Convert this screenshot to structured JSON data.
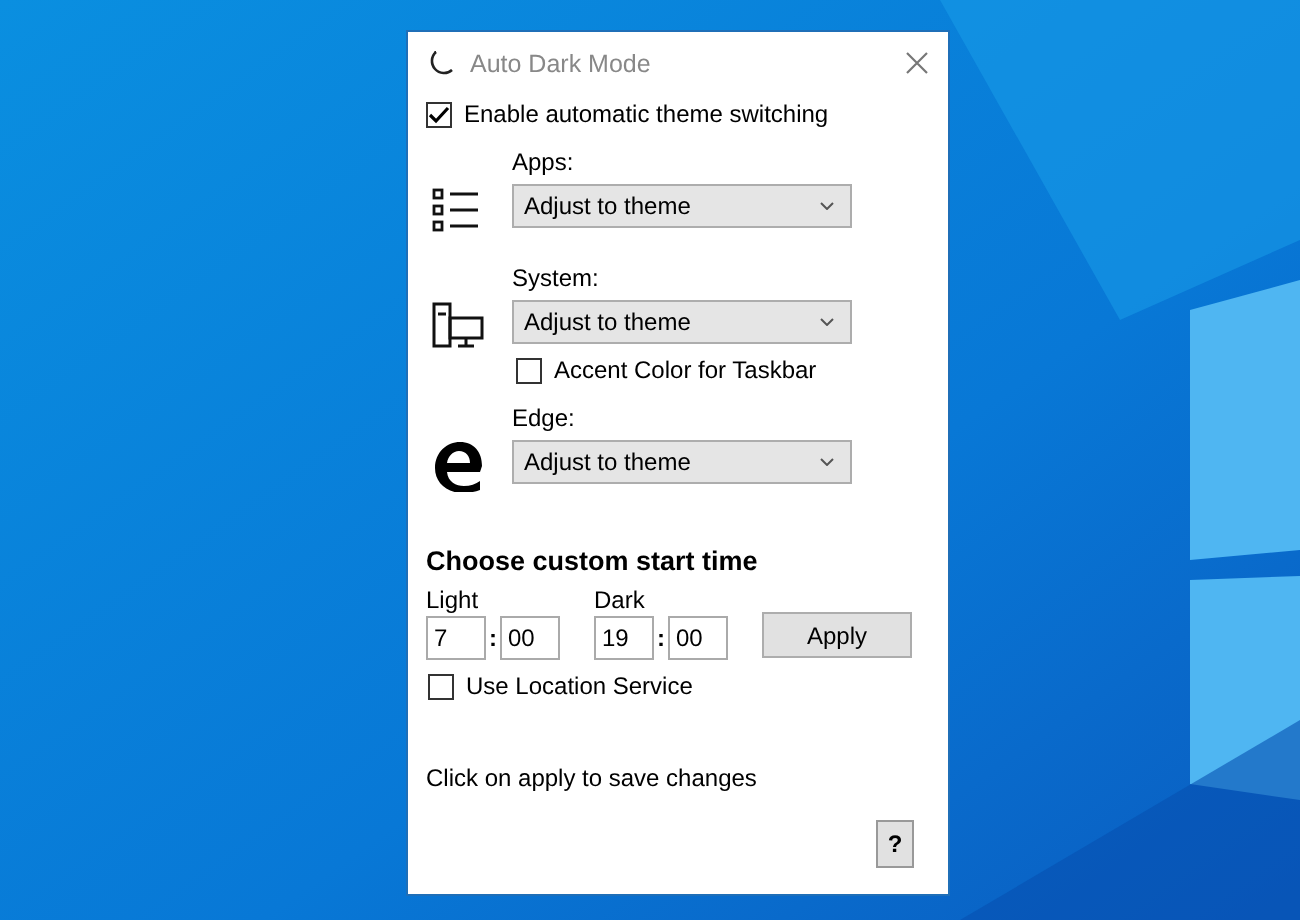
{
  "window": {
    "title": "Auto Dark Mode"
  },
  "enable": {
    "label": "Enable automatic theme switching",
    "checked": true
  },
  "settings": [
    {
      "kind": "apps",
      "label": "Apps:",
      "value": "Adjust to theme"
    },
    {
      "kind": "system",
      "label": "System:",
      "value": "Adjust to theme",
      "option": {
        "label": "Accent Color for Taskbar",
        "checked": false
      }
    },
    {
      "kind": "edge",
      "label": "Edge:",
      "value": "Adjust to theme"
    }
  ],
  "time": {
    "heading": "Choose custom start time",
    "slots": [
      {
        "label": "Light",
        "hour": "7",
        "separator": ":",
        "minute": "00"
      },
      {
        "label": "Dark",
        "hour": "19",
        "separator": ":",
        "minute": "00"
      }
    ],
    "apply": "Apply"
  },
  "location": {
    "label": "Use Location Service",
    "checked": false
  },
  "hint": "Click on apply to save changes",
  "help": "?"
}
